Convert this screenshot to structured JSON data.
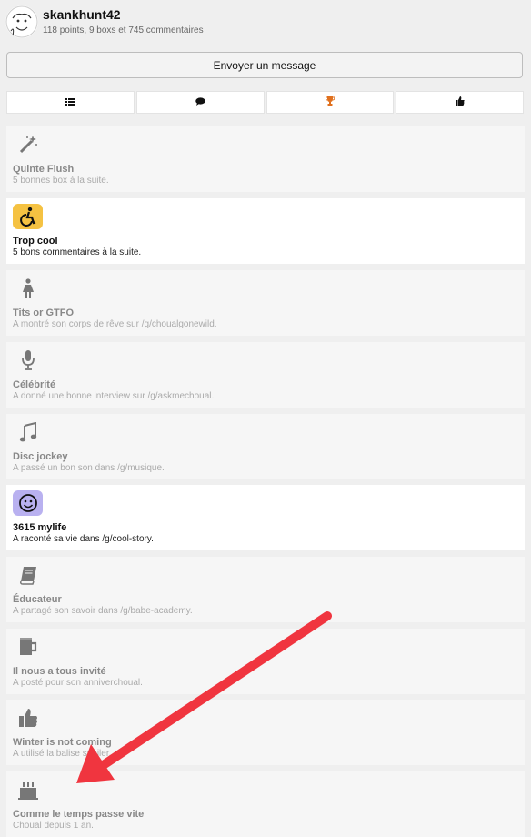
{
  "profile": {
    "username": "skankhunt42",
    "stats": "118 points, 9 boxs et 745 commentaires"
  },
  "message_button": "Envoyer un message",
  "tabs": [
    {
      "icon": "list-icon",
      "color": "#111111"
    },
    {
      "icon": "speech-bubble-icon",
      "color": "#111111"
    },
    {
      "icon": "trophy-icon",
      "color": "#e0701e"
    },
    {
      "icon": "thumbs-up-icon",
      "color": "#111111"
    }
  ],
  "badges": [
    {
      "title": "Quinte Flush",
      "desc": "5 bonnes box à la suite.",
      "icon": "magic-wand-icon",
      "earned": false
    },
    {
      "title": "Trop cool",
      "desc": "5 bons commentaires à la suite.",
      "icon": "wheelchair-icon",
      "earned": true,
      "color": "#f5c242"
    },
    {
      "title": "Tits or GTFO",
      "desc": "A montré son corps de rêve sur /g/choualgonewild.",
      "icon": "female-figure-icon",
      "earned": false
    },
    {
      "title": "Célébrité",
      "desc": "A donné une bonne interview sur /g/askmechoual.",
      "icon": "microphone-icon",
      "earned": false
    },
    {
      "title": "Disc jockey",
      "desc": "A passé un bon son dans /g/musique.",
      "icon": "music-note-icon",
      "earned": false
    },
    {
      "title": "3615 mylife",
      "desc": "A raconté sa vie dans /g/cool-story.",
      "icon": "smiley-icon",
      "earned": true,
      "color": "#b9b1f0"
    },
    {
      "title": "Éducateur",
      "desc": "A partagé son savoir dans /g/babe-academy.",
      "icon": "book-icon",
      "earned": false
    },
    {
      "title": "Il nous a tous invité",
      "desc": "A posté pour son anniverchoual.",
      "icon": "beer-mug-icon",
      "earned": false
    },
    {
      "title": "Winter is not coming",
      "desc": "A utilisé la balise spoiler.",
      "icon": "thumbs-up-icon",
      "earned": false
    },
    {
      "title": "Comme le temps passe vite",
      "desc": "Choual depuis 1 an.",
      "icon": "birthday-cake-icon",
      "earned": false
    }
  ],
  "annotation": {
    "type": "arrow",
    "color": "#f0353f"
  }
}
